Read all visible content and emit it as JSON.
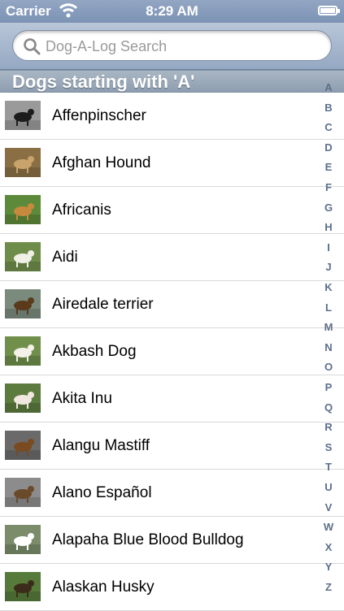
{
  "status": {
    "carrier": "Carrier",
    "time": "8:29 AM"
  },
  "search": {
    "placeholder": "Dog-A-Log Search"
  },
  "section": {
    "title": "Dogs starting with 'A'"
  },
  "dogs": [
    {
      "name": "Affenpinscher",
      "thumb": "affenpinscher-photo"
    },
    {
      "name": "Afghan Hound",
      "thumb": "afghan-hound-photo"
    },
    {
      "name": "Africanis",
      "thumb": "africanis-photo"
    },
    {
      "name": "Aidi",
      "thumb": "aidi-photo"
    },
    {
      "name": "Airedale terrier",
      "thumb": "airedale-terrier-photo"
    },
    {
      "name": "Akbash Dog",
      "thumb": "akbash-dog-photo"
    },
    {
      "name": "Akita Inu",
      "thumb": "akita-inu-photo"
    },
    {
      "name": "Alangu Mastiff",
      "thumb": "alangu-mastiff-photo"
    },
    {
      "name": "Alano Español",
      "thumb": "alano-espanol-photo"
    },
    {
      "name": "Alapaha Blue Blood Bulldog",
      "thumb": "alapaha-blue-blood-bulldog-photo"
    },
    {
      "name": "Alaskan Husky",
      "thumb": "alaskan-husky-photo"
    }
  ],
  "index": [
    "A",
    "B",
    "C",
    "D",
    "E",
    "F",
    "G",
    "H",
    "I",
    "J",
    "K",
    "L",
    "M",
    "N",
    "O",
    "P",
    "Q",
    "R",
    "S",
    "T",
    "U",
    "V",
    "W",
    "X",
    "Y",
    "Z"
  ],
  "colors": {
    "bar": "#8a9fbd",
    "index": "#5c6f8a"
  }
}
